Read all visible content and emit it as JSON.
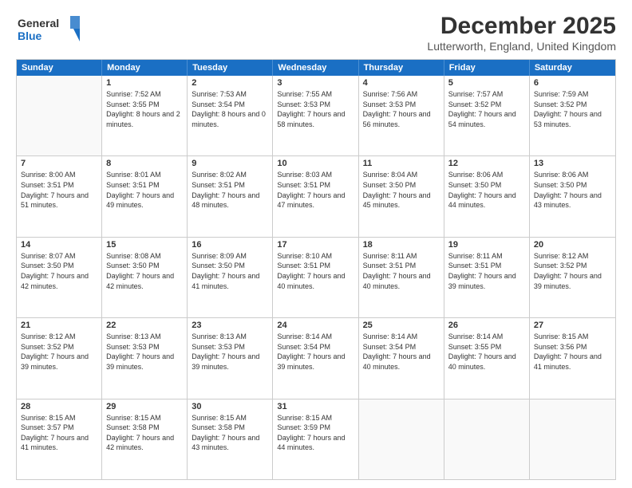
{
  "header": {
    "logo_general": "General",
    "logo_blue": "Blue",
    "month_title": "December 2025",
    "location": "Lutterworth, England, United Kingdom"
  },
  "weekdays": [
    "Sunday",
    "Monday",
    "Tuesday",
    "Wednesday",
    "Thursday",
    "Friday",
    "Saturday"
  ],
  "rows": [
    [
      {
        "day": "",
        "sunrise": "",
        "sunset": "",
        "daylight": ""
      },
      {
        "day": "1",
        "sunrise": "Sunrise: 7:52 AM",
        "sunset": "Sunset: 3:55 PM",
        "daylight": "Daylight: 8 hours and 2 minutes."
      },
      {
        "day": "2",
        "sunrise": "Sunrise: 7:53 AM",
        "sunset": "Sunset: 3:54 PM",
        "daylight": "Daylight: 8 hours and 0 minutes."
      },
      {
        "day": "3",
        "sunrise": "Sunrise: 7:55 AM",
        "sunset": "Sunset: 3:53 PM",
        "daylight": "Daylight: 7 hours and 58 minutes."
      },
      {
        "day": "4",
        "sunrise": "Sunrise: 7:56 AM",
        "sunset": "Sunset: 3:53 PM",
        "daylight": "Daylight: 7 hours and 56 minutes."
      },
      {
        "day": "5",
        "sunrise": "Sunrise: 7:57 AM",
        "sunset": "Sunset: 3:52 PM",
        "daylight": "Daylight: 7 hours and 54 minutes."
      },
      {
        "day": "6",
        "sunrise": "Sunrise: 7:59 AM",
        "sunset": "Sunset: 3:52 PM",
        "daylight": "Daylight: 7 hours and 53 minutes."
      }
    ],
    [
      {
        "day": "7",
        "sunrise": "Sunrise: 8:00 AM",
        "sunset": "Sunset: 3:51 PM",
        "daylight": "Daylight: 7 hours and 51 minutes."
      },
      {
        "day": "8",
        "sunrise": "Sunrise: 8:01 AM",
        "sunset": "Sunset: 3:51 PM",
        "daylight": "Daylight: 7 hours and 49 minutes."
      },
      {
        "day": "9",
        "sunrise": "Sunrise: 8:02 AM",
        "sunset": "Sunset: 3:51 PM",
        "daylight": "Daylight: 7 hours and 48 minutes."
      },
      {
        "day": "10",
        "sunrise": "Sunrise: 8:03 AM",
        "sunset": "Sunset: 3:51 PM",
        "daylight": "Daylight: 7 hours and 47 minutes."
      },
      {
        "day": "11",
        "sunrise": "Sunrise: 8:04 AM",
        "sunset": "Sunset: 3:50 PM",
        "daylight": "Daylight: 7 hours and 45 minutes."
      },
      {
        "day": "12",
        "sunrise": "Sunrise: 8:06 AM",
        "sunset": "Sunset: 3:50 PM",
        "daylight": "Daylight: 7 hours and 44 minutes."
      },
      {
        "day": "13",
        "sunrise": "Sunrise: 8:06 AM",
        "sunset": "Sunset: 3:50 PM",
        "daylight": "Daylight: 7 hours and 43 minutes."
      }
    ],
    [
      {
        "day": "14",
        "sunrise": "Sunrise: 8:07 AM",
        "sunset": "Sunset: 3:50 PM",
        "daylight": "Daylight: 7 hours and 42 minutes."
      },
      {
        "day": "15",
        "sunrise": "Sunrise: 8:08 AM",
        "sunset": "Sunset: 3:50 PM",
        "daylight": "Daylight: 7 hours and 42 minutes."
      },
      {
        "day": "16",
        "sunrise": "Sunrise: 8:09 AM",
        "sunset": "Sunset: 3:50 PM",
        "daylight": "Daylight: 7 hours and 41 minutes."
      },
      {
        "day": "17",
        "sunrise": "Sunrise: 8:10 AM",
        "sunset": "Sunset: 3:51 PM",
        "daylight": "Daylight: 7 hours and 40 minutes."
      },
      {
        "day": "18",
        "sunrise": "Sunrise: 8:11 AM",
        "sunset": "Sunset: 3:51 PM",
        "daylight": "Daylight: 7 hours and 40 minutes."
      },
      {
        "day": "19",
        "sunrise": "Sunrise: 8:11 AM",
        "sunset": "Sunset: 3:51 PM",
        "daylight": "Daylight: 7 hours and 39 minutes."
      },
      {
        "day": "20",
        "sunrise": "Sunrise: 8:12 AM",
        "sunset": "Sunset: 3:52 PM",
        "daylight": "Daylight: 7 hours and 39 minutes."
      }
    ],
    [
      {
        "day": "21",
        "sunrise": "Sunrise: 8:12 AM",
        "sunset": "Sunset: 3:52 PM",
        "daylight": "Daylight: 7 hours and 39 minutes."
      },
      {
        "day": "22",
        "sunrise": "Sunrise: 8:13 AM",
        "sunset": "Sunset: 3:53 PM",
        "daylight": "Daylight: 7 hours and 39 minutes."
      },
      {
        "day": "23",
        "sunrise": "Sunrise: 8:13 AM",
        "sunset": "Sunset: 3:53 PM",
        "daylight": "Daylight: 7 hours and 39 minutes."
      },
      {
        "day": "24",
        "sunrise": "Sunrise: 8:14 AM",
        "sunset": "Sunset: 3:54 PM",
        "daylight": "Daylight: 7 hours and 39 minutes."
      },
      {
        "day": "25",
        "sunrise": "Sunrise: 8:14 AM",
        "sunset": "Sunset: 3:54 PM",
        "daylight": "Daylight: 7 hours and 40 minutes."
      },
      {
        "day": "26",
        "sunrise": "Sunrise: 8:14 AM",
        "sunset": "Sunset: 3:55 PM",
        "daylight": "Daylight: 7 hours and 40 minutes."
      },
      {
        "day": "27",
        "sunrise": "Sunrise: 8:15 AM",
        "sunset": "Sunset: 3:56 PM",
        "daylight": "Daylight: 7 hours and 41 minutes."
      }
    ],
    [
      {
        "day": "28",
        "sunrise": "Sunrise: 8:15 AM",
        "sunset": "Sunset: 3:57 PM",
        "daylight": "Daylight: 7 hours and 41 minutes."
      },
      {
        "day": "29",
        "sunrise": "Sunrise: 8:15 AM",
        "sunset": "Sunset: 3:58 PM",
        "daylight": "Daylight: 7 hours and 42 minutes."
      },
      {
        "day": "30",
        "sunrise": "Sunrise: 8:15 AM",
        "sunset": "Sunset: 3:58 PM",
        "daylight": "Daylight: 7 hours and 43 minutes."
      },
      {
        "day": "31",
        "sunrise": "Sunrise: 8:15 AM",
        "sunset": "Sunset: 3:59 PM",
        "daylight": "Daylight: 7 hours and 44 minutes."
      },
      {
        "day": "",
        "sunrise": "",
        "sunset": "",
        "daylight": ""
      },
      {
        "day": "",
        "sunrise": "",
        "sunset": "",
        "daylight": ""
      },
      {
        "day": "",
        "sunrise": "",
        "sunset": "",
        "daylight": ""
      }
    ]
  ]
}
